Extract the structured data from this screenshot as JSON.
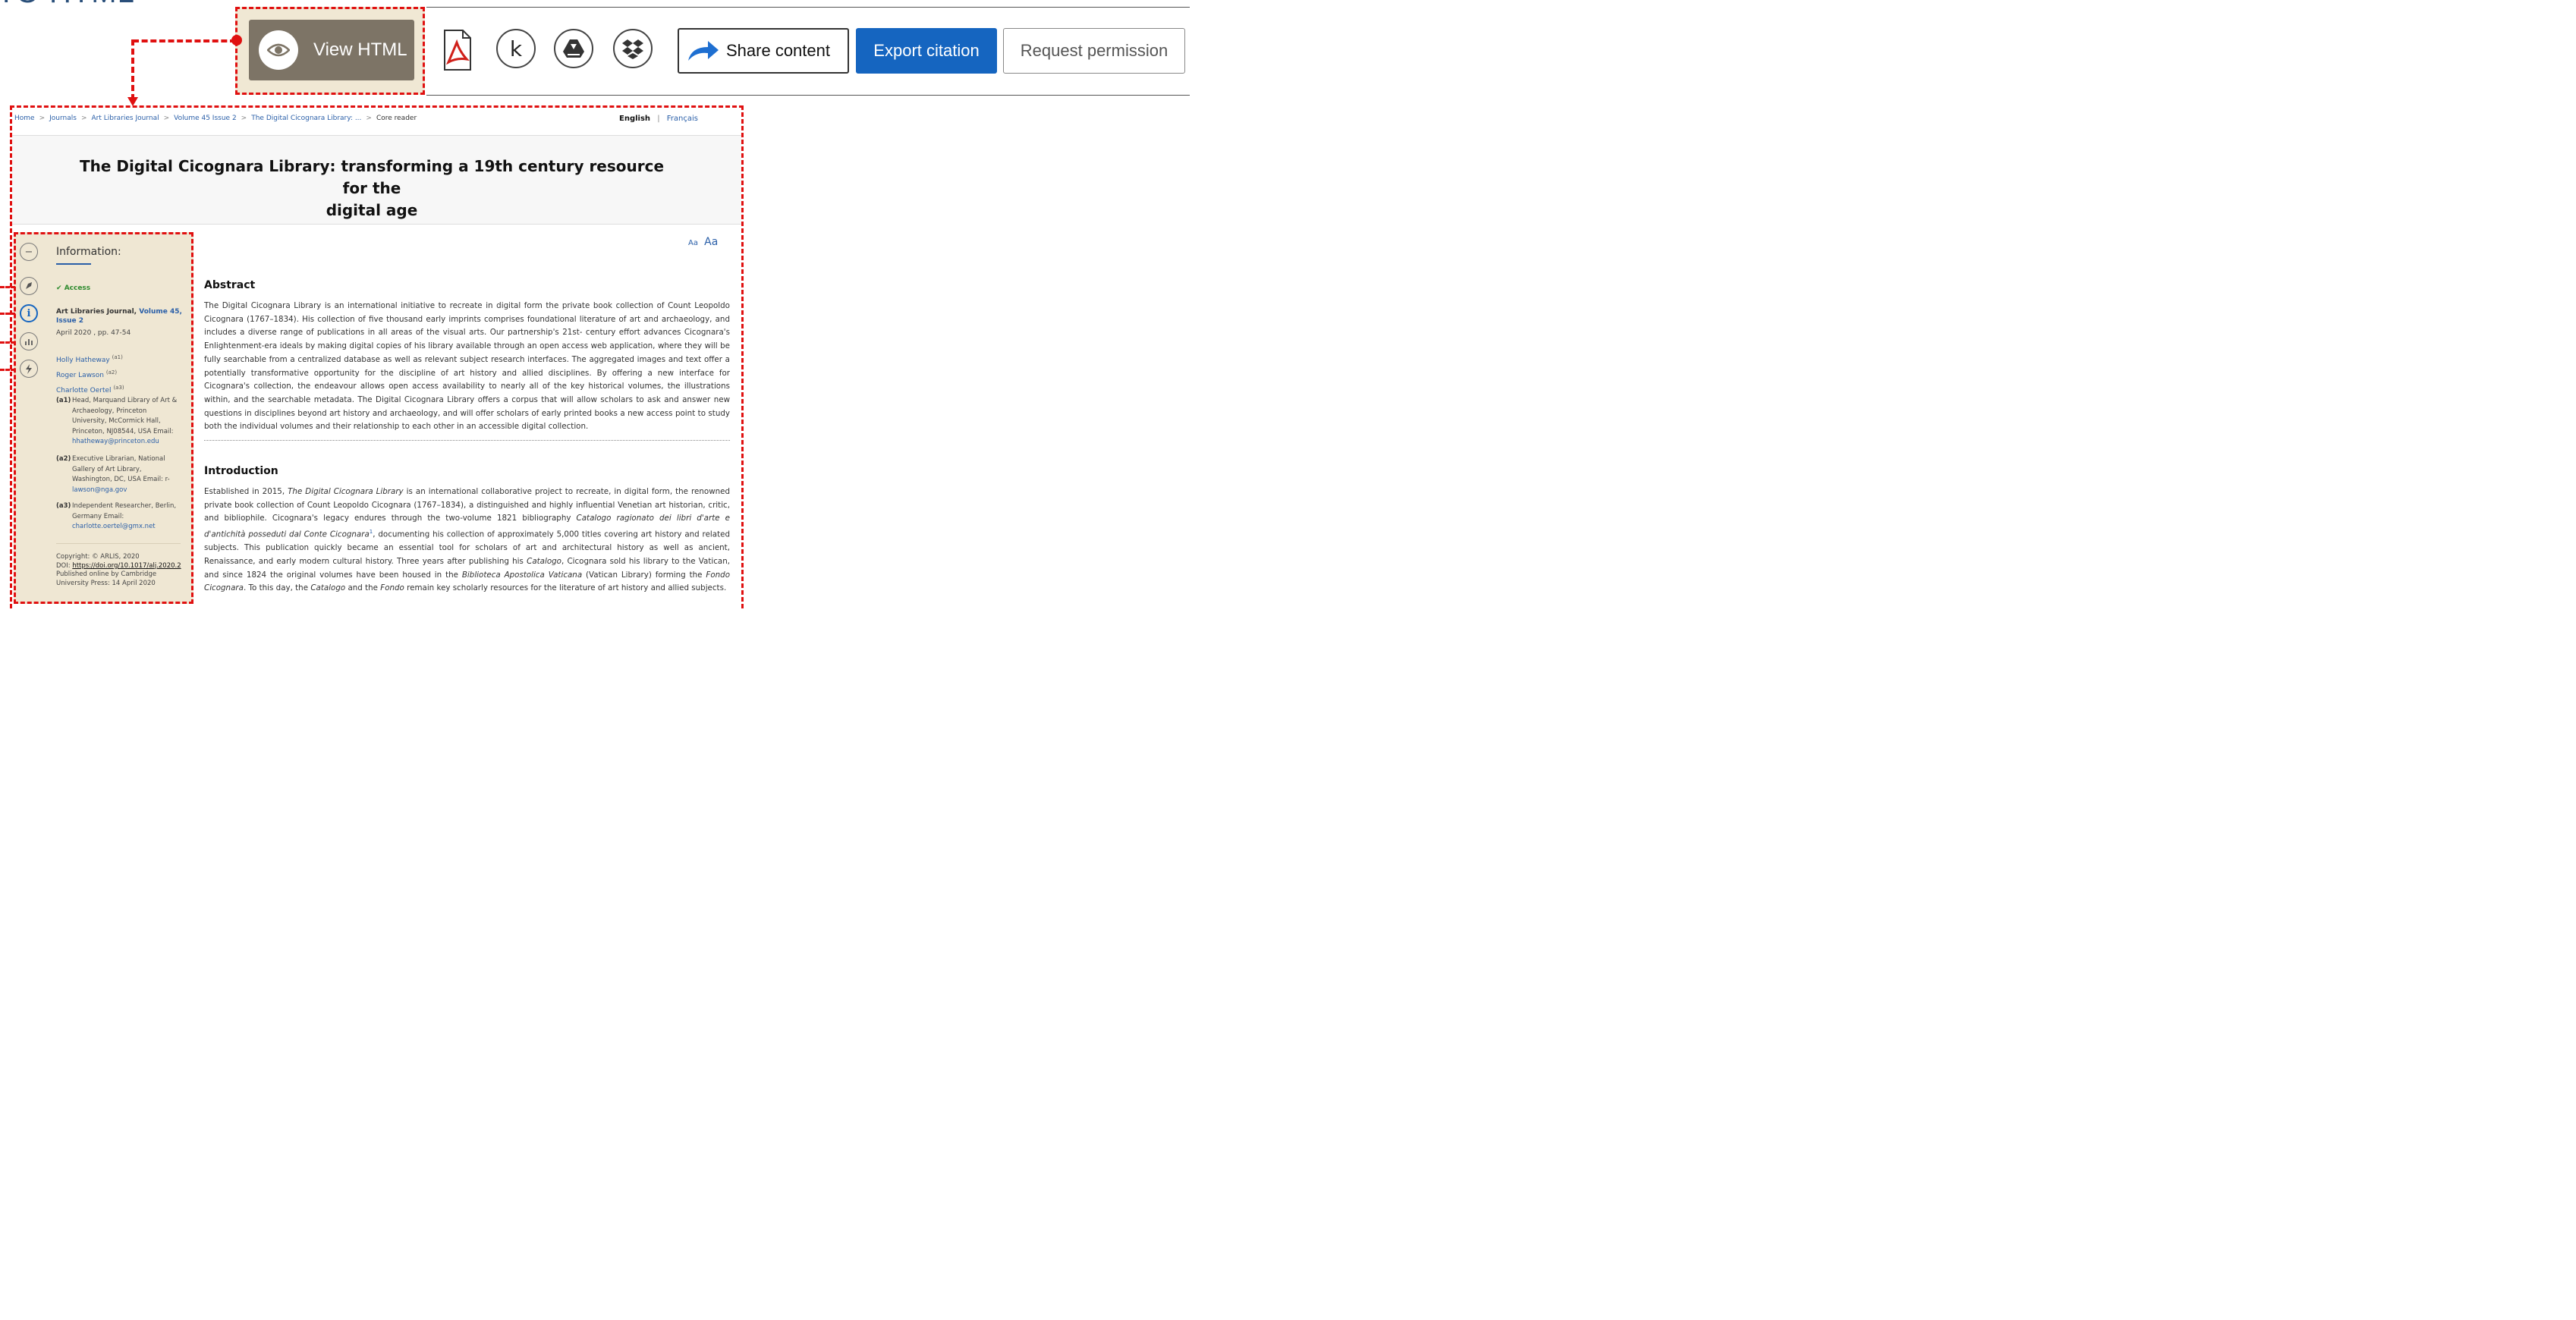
{
  "top_fragment": "TO HTML",
  "toolbar": {
    "view_html_label": "View HTML",
    "share_label": "Share content",
    "export_label": "Export citation",
    "request_label": "Request permission"
  },
  "breadcrumb": {
    "items": [
      "Home",
      "Journals",
      "Art Libraries Journal",
      "Volume 45 Issue 2",
      "The Digital Cicognara Library: ..."
    ],
    "current": "Core reader",
    "separator": ">"
  },
  "language": {
    "english": "English",
    "separator": "|",
    "french": "Français"
  },
  "article": {
    "title_line1": "The Digital Cicognara Library: transforming a 19th century resource for the",
    "title_line2": "digital age"
  },
  "sidebar": {
    "info_title": "Information:",
    "access": "Access",
    "journal_name": "Art Libraries Journal,",
    "volume": "Volume 45, Issue 2",
    "date_pages": "April 2020 , pp. 47-54",
    "authors": [
      {
        "name": "Holly Hatheway",
        "sup": "(a1)"
      },
      {
        "name": "Roger Lawson",
        "sup": "(a2)"
      },
      {
        "name": "Charlotte Oertel",
        "sup": "(a3)"
      }
    ],
    "affiliations": [
      {
        "tag": "(a1)",
        "text": "Head, Marquand Library of Art & Archaeology, Princeton University, McCormick Hall, Princeton, NJ08544, USA Email:",
        "email": "hhatheway@princeton.edu"
      },
      {
        "tag": "(a2)",
        "text": "Executive Librarian, National Gallery of Art Library, Washington, DC, USA Email: r-",
        "email": "lawson@nga.gov"
      },
      {
        "tag": "(a3)",
        "text": "Independent Researcher, Berlin, Germany Email:",
        "email": "charlotte.oertel@gmx.net"
      }
    ],
    "copyright": "Copyright: © ARLIS, 2020",
    "doi_label": "DOI:",
    "doi": "https://doi.org/10.1017/alj.2020.2",
    "published": "Published online by Cambridge University Press: 14 April 2020"
  },
  "font_toggle": {
    "small": "Aa",
    "large": "Aa"
  },
  "abstract": {
    "heading": "Abstract",
    "text": "The Digital Cicognara Library is an international initiative to recreate in digital form the private book collection of Count Leopoldo Cicognara (1767–1834). His collection of five thousand early imprints comprises foundational literature of art and archaeology, and includes a diverse range of publications in all areas of the visual arts. Our partnership's 21st- century effort advances Cicognara's Enlightenment-era ideals by making digital copies of his library available through an open access web application, where they will be fully searchable from a centralized database as well as relevant subject research interfaces. The aggregated images and text offer a potentially transformative opportunity for the discipline of art history and allied disciplines. By offering a new interface for Cicognara's collection, the endeavour allows open access availability to nearly all of the key historical volumes, the illustrations within, and the searchable metadata. The Digital Cicognara Library offers a corpus that will allow scholars to ask and answer new questions in disciplines beyond art history and archaeology, and will offer scholars of early printed books a new access point to study both the individual volumes and their relationship to each other in an accessible digital collection."
  },
  "introduction": {
    "heading": "Introduction",
    "p1": "Established in 2015, ",
    "i1": "The Digital Cicognara Library",
    "p2": " is an international collaborative project to recreate, in digital form, the renowned private book collection of Count Leopoldo Cicognara (1767–1834), a distinguished and highly influential Venetian art historian, critic, and bibliophile. Cicognara's legacy endures through the two-volume 1821 bibliography ",
    "i2": "Catalogo ragionato dei libri d'arte e d'antichità posseduti dal Conte Cicognara",
    "fn": "1",
    "p3": ", documenting his collection of approximately 5,000 titles covering art history and related subjects. This publication quickly became an essential tool for scholars of art and architectural history as well as ancient, Renaissance, and early modern cultural history. Three years after publishing his ",
    "i3": "Catalogo",
    "p4": ", Cicognara sold his library to the Vatican, and since 1824 the original volumes have been housed in the ",
    "i4": "Biblioteca Apostolica Vaticana",
    "p5": " (Vatican Library) forming the ",
    "i5": "Fondo Cicognara",
    "p6": ". To this day, the ",
    "i6": "Catalogo",
    "p7": " and the ",
    "i7": "Fondo",
    "p8": " remain key scholarly resources for the literature of art history and allied subjects."
  },
  "colors": {
    "accent": "#1565c0",
    "annotation": "#e01010",
    "sidebar_bg": "#efe7d3",
    "view_btn": "#7d7466"
  }
}
